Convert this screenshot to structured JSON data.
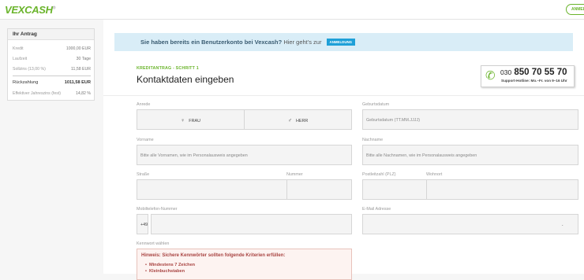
{
  "header": {
    "logo": "VEXCASH",
    "login_label": "ANMELDUNG"
  },
  "sidebar": {
    "title": "Ihr Antrag",
    "rows": [
      {
        "label": "Kredit",
        "value": "1000,00 EUR"
      },
      {
        "label": "Laufzeit",
        "value": "30 Tage"
      },
      {
        "label": "Sollzins (13,00 %)",
        "value": "11,58 EUR"
      }
    ],
    "total": {
      "label": "Rückzahlung",
      "value": "1011,58 EUR"
    },
    "apr": {
      "label": "Effektiver Jahreszins (fest)",
      "value": "14,82 %"
    }
  },
  "banner": {
    "strong": "Sie haben bereits ein Benutzerkonto bei Vexcash?",
    "text": "Hier geht's zur",
    "button": "ANMELDUNG"
  },
  "form": {
    "step": "KREDITANTRAG - SCHRITT 1",
    "title": "Kontaktdaten eingeben",
    "hotline": {
      "prefix": "030",
      "number": "850 70 55 70",
      "sub": "Support-Hotline: Mo.–Fr. von 9–16 Uhr"
    },
    "salutation_label": "Anrede",
    "salutation_options": [
      "FRAU",
      "HERR"
    ],
    "birthdate_label": "Geburtsdatum",
    "birthdate_placeholder": "Geburtsdatum (TT.MM.JJJJ)",
    "firstname_label": "Vorname",
    "firstname_placeholder": "Bitte alle Vornamen, wie im Personalausweis angegeben",
    "lastname_label": "Nachname",
    "lastname_placeholder": "Bitte alle Nachnamen, wie im Personalausweis angegeben",
    "street_label": "Straße",
    "number_label": "Nummer",
    "zip_label": "Postleitzahl (PLZ)",
    "city_label": "Wohnort",
    "mobile_label": "Mobiltelefon-Nummer",
    "mobile_prefix": "+49",
    "email_label": "E-Mail Adresse",
    "password_label": "Kennwort wählen",
    "hint": {
      "title": "Hinweis: Sichere Kennwörter sollten folgende Kriterien erfüllen:",
      "items": [
        "Mindestens 7 Zeichen",
        "Kleinbuchstaben"
      ]
    }
  },
  "colors": {
    "brand": "#6ab42b",
    "info_bg": "#d9edf7",
    "info_button": "#1fa0d8",
    "hint_text": "#a94442"
  },
  "icons": [
    "phone-icon",
    "female-icon",
    "male-icon"
  ]
}
